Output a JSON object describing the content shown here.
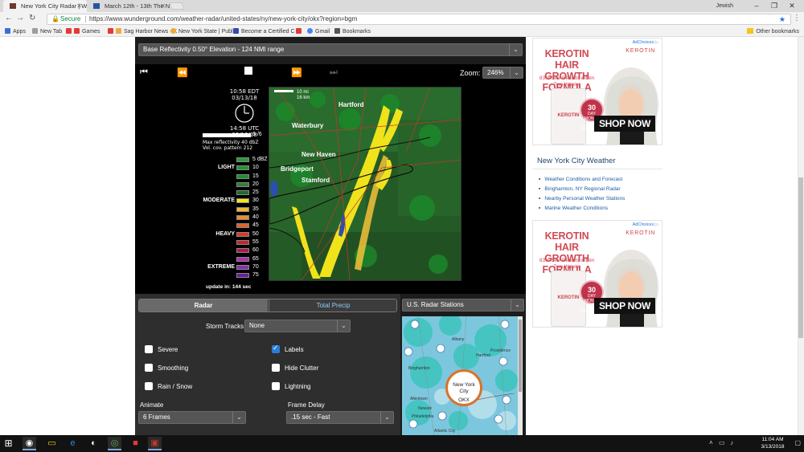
{
  "browser": {
    "tabs": [
      {
        "title": "New York City Radar | W",
        "active": true
      },
      {
        "title": "March 12th - 13th The N",
        "active": false
      }
    ],
    "user": "Jewish",
    "url": "https://www.wunderground.com/weather-radar/united-states/ny/new-york-city/okx?region=bgm",
    "secure_label": "Secure",
    "bookmarks": [
      {
        "label": "Apps",
        "color": "#3b6fd6"
      },
      {
        "label": "New Tab",
        "color": "#9e9e9e"
      },
      {
        "label": "Games",
        "color": "#e53935"
      },
      {
        "label": "Sag Harbor News - K",
        "color": "#f2a93b"
      },
      {
        "label": "New York State | Publ",
        "color": "#555555"
      },
      {
        "label": "Become a Certified C",
        "color": "#3949ab"
      },
      {
        "label": "",
        "color": "#e53935"
      },
      {
        "label": "Gmail",
        "color": "#4285f4"
      },
      {
        "label": "Bookmarks",
        "color": "#555555"
      }
    ],
    "other_bookmarks": "Other bookmarks"
  },
  "radar": {
    "product": "Base Reflectivity 0.50° Elevation - 124 NMI range",
    "zoom_label": "Zoom:",
    "zoom_value": "246%",
    "time_edt": "10:58 EDT",
    "date1": "03/13/18",
    "time_utc": "14:58 UTC",
    "date2": "03/13/18",
    "frame_counter": "6 /6",
    "frame_progress": 1.0,
    "max_reflectivity": "Max reflectivity 40 dbZ",
    "vcp": "Vol. cov. pattern 212",
    "update": "update in: 144 sec",
    "scale_label": "10 mi\n16 km",
    "legend": [
      {
        "val": "5 dBZ",
        "cat": "",
        "color": "#2c9a3a"
      },
      {
        "val": "10",
        "cat": "LIGHT",
        "color": "#219632"
      },
      {
        "val": "15",
        "cat": "",
        "color": "#1f8f2f"
      },
      {
        "val": "20",
        "cat": "",
        "color": "#2f7f3a"
      },
      {
        "val": "25",
        "cat": "",
        "color": "#1c6b2a"
      },
      {
        "val": "30",
        "cat": "MODERATE",
        "color": "#f5e61b"
      },
      {
        "val": "35",
        "cat": "",
        "color": "#f2b62b"
      },
      {
        "val": "40",
        "cat": "",
        "color": "#ee8a2a"
      },
      {
        "val": "45",
        "cat": "",
        "color": "#e2602a"
      },
      {
        "val": "50",
        "cat": "HEAVY",
        "color": "#d93a2a"
      },
      {
        "val": "55",
        "cat": "",
        "color": "#c6262a"
      },
      {
        "val": "60",
        "cat": "",
        "color": "#b01a4a"
      },
      {
        "val": "65",
        "cat": "",
        "color": "#b52fb0"
      },
      {
        "val": "70",
        "cat": "EXTREME",
        "color": "#8a2fb0"
      },
      {
        "val": "75",
        "cat": "",
        "color": "#6a1f9a"
      }
    ],
    "map_labels": [
      "Waterbury",
      "New Haven",
      "Bridgeport",
      "Hartford",
      "Stamford"
    ]
  },
  "controls": {
    "tab_radar": "Radar",
    "tab_precip": "Total Precip",
    "storm_tracks_label": "Storm Tracks",
    "storm_tracks_value": "None",
    "checkboxes": [
      {
        "label": "Severe",
        "checked": false
      },
      {
        "label": "Labels",
        "checked": true
      },
      {
        "label": "Smoothing",
        "checked": false
      },
      {
        "label": "Hide Clutter",
        "checked": false
      },
      {
        "label": "Rain / Snow",
        "checked": false
      },
      {
        "label": "Lightning",
        "checked": false
      }
    ],
    "animate_label": "Animate",
    "animate_value": "6 Frames",
    "delay_label": "Frame Delay",
    "delay_value": ".15 sec - Fast",
    "stations_value": "U.S. Radar Stations",
    "station_name": "New York City",
    "station_code": "OKX",
    "station_map_labels": [
      "Albany",
      "Hartford",
      "Providence",
      "Binghamton",
      "Allentown",
      "Philadelphia",
      "Atlantic City",
      "Newark"
    ]
  },
  "ads": {
    "choices": "AdChoices",
    "brand": "KEROTIN",
    "title": "KEROTIN HAIR GROWTH FORMULA",
    "subtitle": "83% See Results within Two Weeks",
    "bottle_label": "KEROTIN",
    "badge_days": "30",
    "badge_text": "DAY MONEY BACK GUARANTEE",
    "cta": "SHOP NOW"
  },
  "links": {
    "heading": "New York City Weather",
    "items": [
      "Weather Conditions and Forecast",
      "Binghamton, NY Regional Radar",
      "Nearby Personal Weather Stations",
      "Marine Weather Conditions"
    ]
  },
  "taskbar": {
    "time": "11:04 AM",
    "date": "3/13/2018"
  }
}
